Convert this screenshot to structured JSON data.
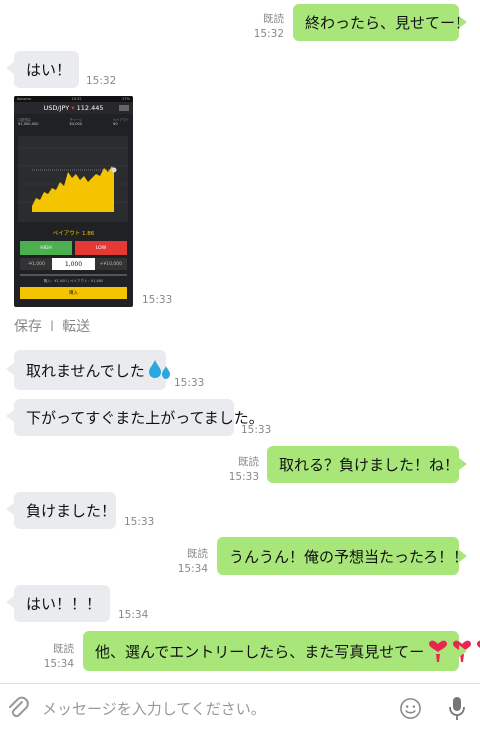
{
  "messages": [
    {
      "id": "m1",
      "dir": "out",
      "read": "既読",
      "time": "15:32",
      "text": "終わったら、見せてー！"
    },
    {
      "id": "m2",
      "dir": "in",
      "time": "15:32",
      "text": "はい！"
    },
    {
      "id": "m3",
      "dir": "in",
      "time": "15:33",
      "type": "image"
    },
    {
      "id": "m4",
      "dir": "in",
      "time": "15:33",
      "text": "取れませんでした",
      "emoji": "sweat-droplets"
    },
    {
      "id": "m5",
      "dir": "in",
      "time": "15:33",
      "text": "下がってすぐまた上がってました。"
    },
    {
      "id": "m6",
      "dir": "out",
      "read": "既読",
      "time": "15:33",
      "text": "取れる？負けました！ね！"
    },
    {
      "id": "m7",
      "dir": "in",
      "time": "15:33",
      "text": "負けました！"
    },
    {
      "id": "m8",
      "dir": "out",
      "read": "既読",
      "time": "15:34",
      "text": "うんうん！俺の予想当たったろ！！"
    },
    {
      "id": "m9",
      "dir": "in",
      "time": "15:34",
      "text": "はい！！！"
    },
    {
      "id": "m10",
      "dir": "out",
      "read": "既読",
      "time": "15:34",
      "text": "他、選んでエントリーしたら、また写真見せてー",
      "emoji": "heart-exclamation-x3"
    }
  ],
  "image_actions": {
    "save": "保存",
    "separator": "I",
    "forward": "転送"
  },
  "screenshot": {
    "status_left": "docomo",
    "status_time": "15:32",
    "status_right": "27%",
    "pair": "USD/JPY",
    "rate": "112.445",
    "col1_label": "口座残高",
    "col1_value": "¥1,000,000",
    "col2_label": "チャージ",
    "col2_value": "¥4,000",
    "col3_label": "ペイアウト",
    "col3_value": "¥0",
    "payout": "ペイアウト 1.86",
    "high": "HIGH",
    "low": "LOW",
    "minus": "-¥1,000",
    "amount": "1,000",
    "plus": "+¥10,000",
    "info": "購入：¥1,000 | ペイアウト：¥1,860",
    "buy": "購入"
  },
  "input": {
    "placeholder": "メッセージを入力してください。"
  },
  "colors": {
    "outgoing": "#a8e67a",
    "incoming": "#e9ebef",
    "meta": "#888888"
  }
}
